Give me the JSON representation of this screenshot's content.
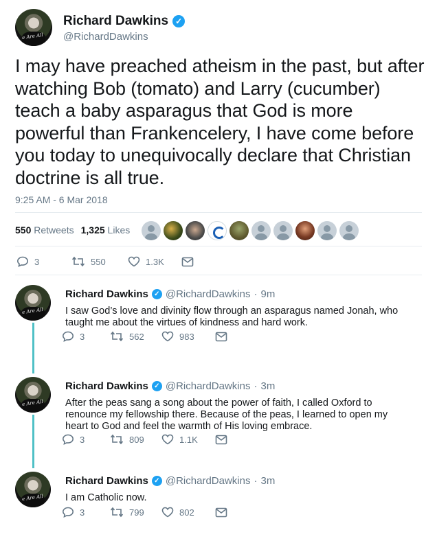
{
  "main_tweet": {
    "name": "Richard Dawkins",
    "handle": "@RichardDawkins",
    "avatar_caption": "e Are All",
    "text": "I may have preached atheism in the past, but after watching Bob (tomato) and Larry (cucumber) teach a baby asparagus that God is more powerful than Frankencelery, I have come before you today to unequivocally declare that Christian doctrine is all true.",
    "timestamp": "9:25 AM - 6 Mar 2018",
    "retweets_count": "550",
    "retweets_label": "Retweets",
    "likes_count": "1,325",
    "likes_label": "Likes",
    "actions": {
      "replies": "3",
      "retweets": "550",
      "likes": "1.3K"
    }
  },
  "replies": [
    {
      "name": "Richard Dawkins",
      "handle": "@RichardDawkins",
      "time": "9m",
      "avatar_caption": "e Are All",
      "text": "I saw God’s love and divinity flow through an asparagus named Jonah, who taught me about the virtues of kindness and hard work.",
      "actions": {
        "replies": "3",
        "retweets": "562",
        "likes": "983"
      }
    },
    {
      "name": "Richard Dawkins",
      "handle": "@RichardDawkins",
      "time": "3m",
      "avatar_caption": "e Are All",
      "text": "After the peas sang a song about the power of faith, I called Oxford to renounce my fellowship there. Because of the peas, I learned to open my heart to God and feel the warmth of His loving embrace.",
      "actions": {
        "replies": "3",
        "retweets": "809",
        "likes": "1.1K"
      }
    },
    {
      "name": "Richard Dawkins",
      "handle": "@RichardDawkins",
      "time": "3m",
      "avatar_caption": "e Are All",
      "text": "I am Catholic now.",
      "actions": {
        "replies": "3",
        "retweets": "799",
        "likes": "802"
      }
    }
  ],
  "icons": [
    "verified-badge-icon",
    "reply-icon",
    "retweet-icon",
    "like-icon",
    "message-icon"
  ],
  "colors": {
    "accent": "#1da1f2",
    "muted": "#657786",
    "thread": "#4fc0c6",
    "text": "#14171a"
  }
}
